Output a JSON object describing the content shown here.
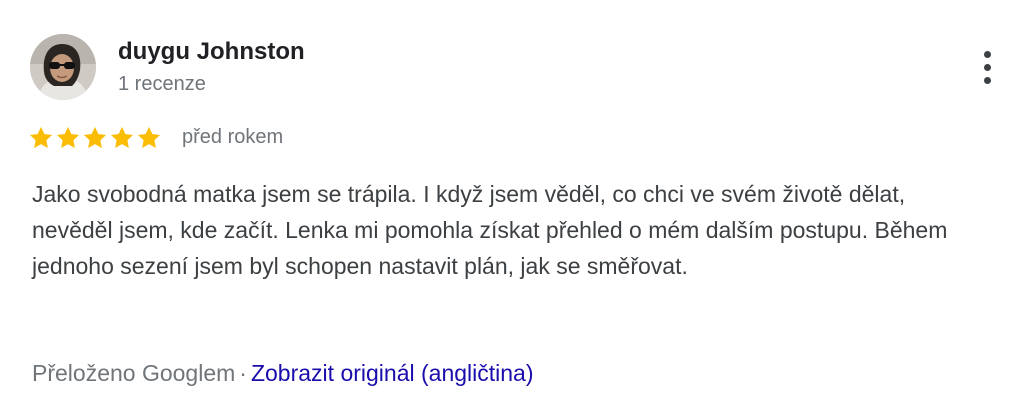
{
  "review": {
    "author_name": "duygu Johnston",
    "review_count": "1 recenze",
    "rating": 5,
    "rating_max": 5,
    "date": "před rokem",
    "text": "Jako svobodná matka jsem se trápila. I když jsem věděl, co chci ve svém životě dělat, nevěděl jsem, kde začít. Lenka mi pomohla získat přehled o mém dalším postupu. Během jednoho sezení jsem byl schopen nastavit plán, jak se směřovat.",
    "translated_by": "Přeloženo Googlem",
    "separator": "·",
    "original_link": "Zobrazit originál (angličtina)"
  },
  "icons": {
    "more_options": "more-vert-icon",
    "star": "star-icon"
  },
  "colors": {
    "star": "#FBBC04",
    "link": "#1A0DAB",
    "secondary_text": "#70757A",
    "body_text": "#3C4043"
  }
}
